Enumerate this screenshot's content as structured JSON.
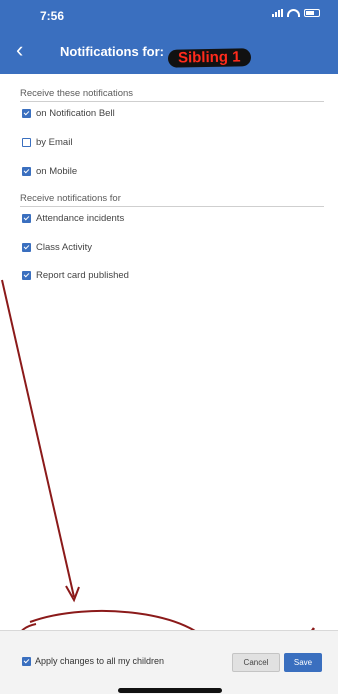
{
  "status_bar": {
    "time": "7:56"
  },
  "header": {
    "back_icon": "‹",
    "title": "Notifications for:",
    "student_name": "Sibling 1"
  },
  "sections": [
    {
      "title": "Receive these notifications",
      "items": [
        {
          "label": "on Notification Bell",
          "checked": true
        },
        {
          "label": "by Email",
          "checked": false
        },
        {
          "label": "on Mobile",
          "checked": true
        }
      ]
    },
    {
      "title": "Receive notifications for",
      "items": [
        {
          "label": "Attendance incidents",
          "checked": true
        },
        {
          "label": "Class Activity",
          "checked": true
        },
        {
          "label": "Report card published",
          "checked": true
        }
      ]
    }
  ],
  "footer": {
    "apply_all_label": "Apply changes to all my children",
    "apply_all_checked": true,
    "cancel_label": "Cancel",
    "save_label": "Save"
  },
  "colors": {
    "accent": "#3a6fbf",
    "annotation_red": "#8b1a1a"
  }
}
